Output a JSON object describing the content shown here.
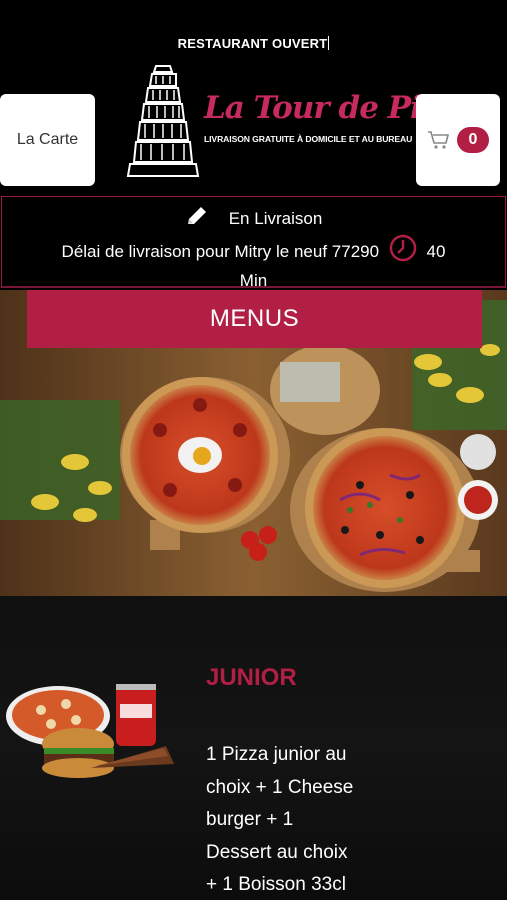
{
  "status": {
    "text": "RESTAURANT OUVERT"
  },
  "header": {
    "carte_label": "La Carte",
    "brand_name": "La Tour de Pizz",
    "tagline": "LIVRAISON GRATUITE À DOMICILE ET AU BUREAU",
    "cart_count": "0"
  },
  "delivery": {
    "mode": "En Livraison",
    "delay_text": "Délai de livraison pour Mitry le neuf 77290",
    "time_value": "40",
    "time_unit": "Min"
  },
  "menus": {
    "label": "MENUS"
  },
  "menu_item": {
    "title": "JUNIOR",
    "description": "1 Pizza junior au\nchoix  + 1 Cheese\nburger  + 1\nDessert au choix\n+ 1 Boisson 33cl"
  },
  "colors": {
    "accent": "#b21f45",
    "background": "#000000"
  },
  "icons": {
    "edit": "pencil-icon",
    "clock": "clock-icon",
    "cart": "cart-icon"
  }
}
